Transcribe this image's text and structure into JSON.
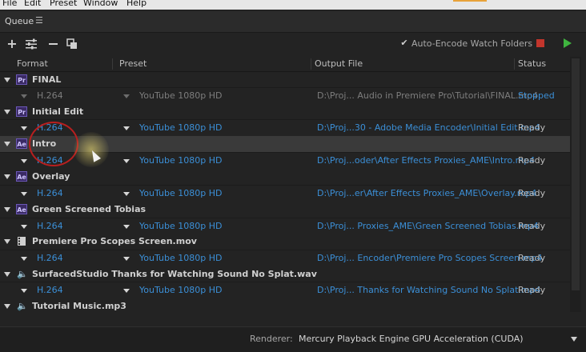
{
  "menubar": {
    "items": [
      "File",
      "Edit",
      "Preset",
      "Window",
      "Help"
    ]
  },
  "panel": {
    "title": "Queue",
    "menu_icon": "hamburger-icon"
  },
  "toolbar": {
    "add_icon": "plus-icon",
    "settings_icon": "sliders-icon",
    "remove_icon": "minus-icon",
    "duplicate_icon": "duplicate-icon",
    "auto_encode_checked": true,
    "auto_encode_check": "✔",
    "auto_encode_label": "Auto-Encode Watch Folders",
    "stop_icon": "stop-icon",
    "start_icon": "play-icon",
    "stop_color": "#c2352c",
    "start_color": "#3fb43f"
  },
  "columns": {
    "format": "Format",
    "preset": "Preset",
    "output": "Output File",
    "status": "Status"
  },
  "queue": [
    {
      "icon": "Pr",
      "name": "FINAL",
      "format": "H.264",
      "preset": "YouTube 1080p HD",
      "output": "D:\\Proj... Audio in Premiere Pro\\Tutorial\\FINAL.mp4",
      "status": "Stopped"
    },
    {
      "icon": "Pr",
      "name": "Initial Edit",
      "format": "H.264",
      "preset": "YouTube 1080p HD",
      "output": "D:\\Proj...30 - Adobe Media Encoder\\Initial Edit.mp4",
      "status": "Ready"
    },
    {
      "icon": "Ae",
      "name": "Intro",
      "format": "H.264",
      "preset": "YouTube 1080p HD",
      "output": "D:\\Proj...oder\\After Effects Proxies_AME\\Intro.mp4",
      "status": "Ready"
    },
    {
      "icon": "Ae",
      "name": "Overlay",
      "format": "H.264",
      "preset": "YouTube 1080p HD",
      "output": "D:\\Proj...er\\After Effects Proxies_AME\\Overlay.mp4",
      "status": "Ready"
    },
    {
      "icon": "Ae",
      "name": "Green Screened Tobias",
      "format": "H.264",
      "preset": "YouTube 1080p HD",
      "output": "D:\\Proj... Proxies_AME\\Green Screened Tobias.mp4",
      "status": "Ready"
    },
    {
      "icon": "film-icon",
      "name": "Premiere Pro Scopes Screen.mov",
      "format": "H.264",
      "preset": "YouTube 1080p HD",
      "output": "D:\\Proj... Encoder\\Premiere Pro Scopes Screen.mp4",
      "status": "Ready"
    },
    {
      "icon": "speaker-icon",
      "name": "SurfacedStudio Thanks for Watching Sound No Splat.wav",
      "format": "H.264",
      "preset": "YouTube 1080p HD",
      "output": "D:\\Proj... Thanks for Watching Sound No Splat.mp4",
      "status": "Ready"
    },
    {
      "icon": "speaker-icon",
      "name": "Tutorial Music.mp3"
    }
  ],
  "footer": {
    "renderer_label": "Renderer:",
    "renderer_value": "Mercury Playback Engine GPU Acceleration (CUDA)"
  }
}
